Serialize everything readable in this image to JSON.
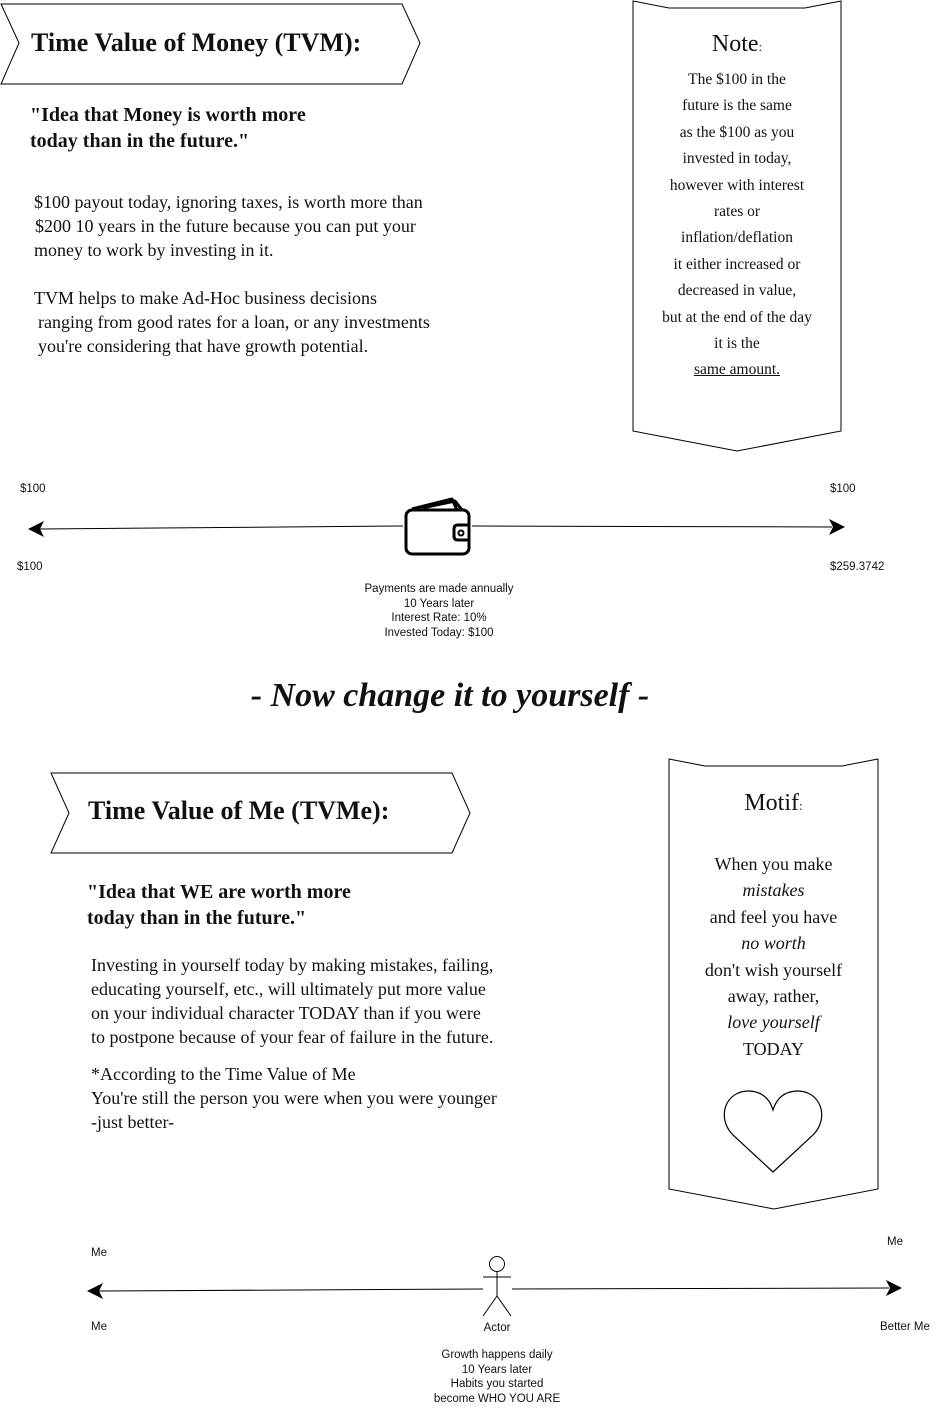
{
  "tvm": {
    "title": "Time Value of Money (TVM):",
    "quote_lines": [
      "\"Idea that Money is worth more",
      "today than in the future.\""
    ],
    "paragraph1_lines": [
      "$100 payout today, ignoring taxes, is worth more than",
      "$200 10 years in the future because you can put your",
      "money to work by investing in it."
    ],
    "paragraph2_lines": [
      "TVM helps to make Ad-Hoc business decisions",
      "ranging from good rates for a loan, or any investments",
      "you're considering that have growth potential."
    ]
  },
  "note": {
    "heading": "Note",
    "colon": ":",
    "lines": [
      "The $100 in the",
      "future is the same",
      "as the $100 as you",
      "invested in today,",
      "however with interest",
      "rates or",
      "inflation/deflation",
      "it either increased or",
      "decreased in value,",
      "but at the end of the day",
      "it is the"
    ],
    "underlined_line": "same amount."
  },
  "money_timeline": {
    "left_top": "$100",
    "left_bottom": "$100",
    "right_top": "$100",
    "right_bottom": "$259.3742",
    "icon": "wallet-icon",
    "caption_lines": [
      "Payments are made annually",
      "10 Years later",
      "Interest Rate: 10%",
      "Invested Today: $100"
    ]
  },
  "banner": "- Now change it to yourself -",
  "tvme": {
    "title": "Time Value of Me (TVMe):",
    "quote_lines": [
      "\"Idea that WE are worth more",
      "today than in the future.\""
    ],
    "paragraph1_lines": [
      "Investing in yourself today by making mistakes, failing,",
      "educating yourself, etc., will ultimately put more value",
      "on your individual character TODAY than if you were",
      "to postpone because of your fear of failure in the future."
    ],
    "paragraph2_lines": [
      "*According to the Time Value of Me",
      "You're still the person you were when you were younger",
      "-just better-"
    ]
  },
  "motif": {
    "heading": "Motif",
    "colon": ":",
    "lines": [
      {
        "text": "When you make",
        "italic": false
      },
      {
        "text": "mistakes",
        "italic": true
      },
      {
        "text": "and feel you have",
        "italic": false
      },
      {
        "text": "no worth",
        "italic": true
      },
      {
        "text": "don't wish yourself",
        "italic": false
      },
      {
        "text": "away, rather,",
        "italic": false
      },
      {
        "text": "love yourself",
        "italic": true
      },
      {
        "text": "TODAY",
        "italic": false
      }
    ],
    "icon": "heart-icon"
  },
  "me_timeline": {
    "left_top": "Me",
    "left_bottom": "Me",
    "right_top": "Me",
    "right_bottom": "Better Me",
    "actor_label": "Actor",
    "icon": "stick-figure-icon",
    "caption_lines": [
      "Growth happens daily",
      "10 Years later",
      "Habits you started",
      "become WHO YOU ARE"
    ]
  }
}
